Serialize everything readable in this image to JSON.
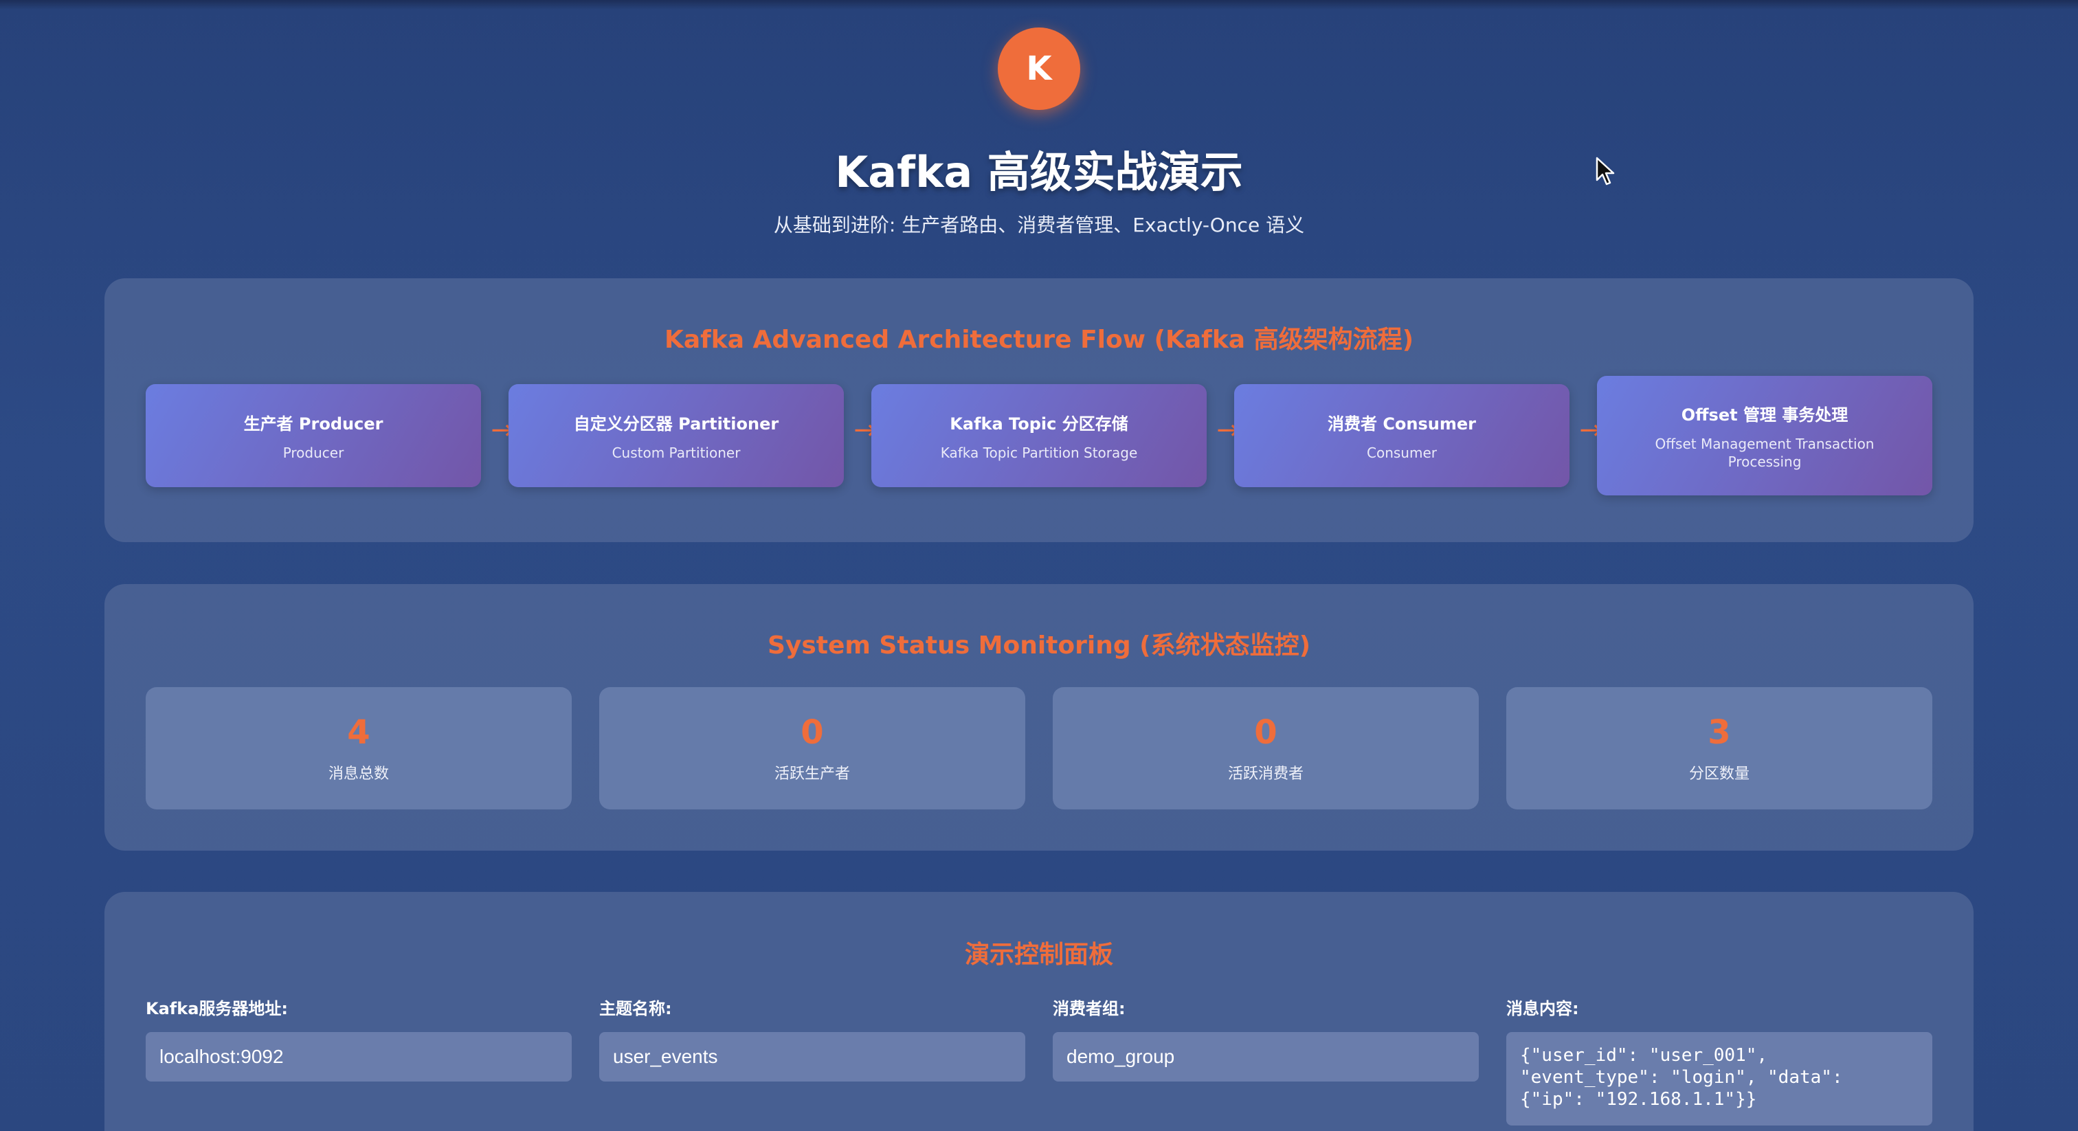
{
  "header": {
    "logo_letter": "K",
    "title": "Kafka 高级实战演示",
    "subtitle": "从基础到进阶: 生产者路由、消费者管理、Exactly-Once 语义"
  },
  "architecture": {
    "title": "Kafka Advanced Architecture Flow (Kafka 高级架构流程)",
    "arrow": "→",
    "steps": [
      {
        "title": "生产者 Producer",
        "subtitle": "Producer"
      },
      {
        "title": "自定义分区器 Partitioner",
        "subtitle": "Custom Partitioner"
      },
      {
        "title": "Kafka Topic 分区存储",
        "subtitle": "Kafka Topic Partition Storage"
      },
      {
        "title": "消费者 Consumer",
        "subtitle": "Consumer"
      },
      {
        "title": "Offset 管理 事务处理",
        "subtitle": "Offset Management Transaction Processing"
      }
    ]
  },
  "status": {
    "title": "System Status Monitoring (系统状态监控)",
    "stats": [
      {
        "value": "4",
        "label": "消息总数"
      },
      {
        "value": "0",
        "label": "活跃生产者"
      },
      {
        "value": "0",
        "label": "活跃消费者"
      },
      {
        "value": "3",
        "label": "分区数量"
      }
    ]
  },
  "controls": {
    "title": "演示控制面板",
    "server_label": "Kafka服务器地址:",
    "server_value": "localhost:9092",
    "topic_label": "主题名称:",
    "topic_value": "user_events",
    "group_label": "消费者组:",
    "group_value": "demo_group",
    "message_label": "消息内容:",
    "message_value": "{\"user_id\": \"user_001\",\n\"event_type\": \"login\", \"data\":\n{\"ip\": \"192.168.1.1\"}}"
  },
  "colors": {
    "accent": "#ef6d3b",
    "background": "#2d4a85",
    "card_gradient_start": "#6b7de0",
    "card_gradient_end": "#7356a8"
  }
}
